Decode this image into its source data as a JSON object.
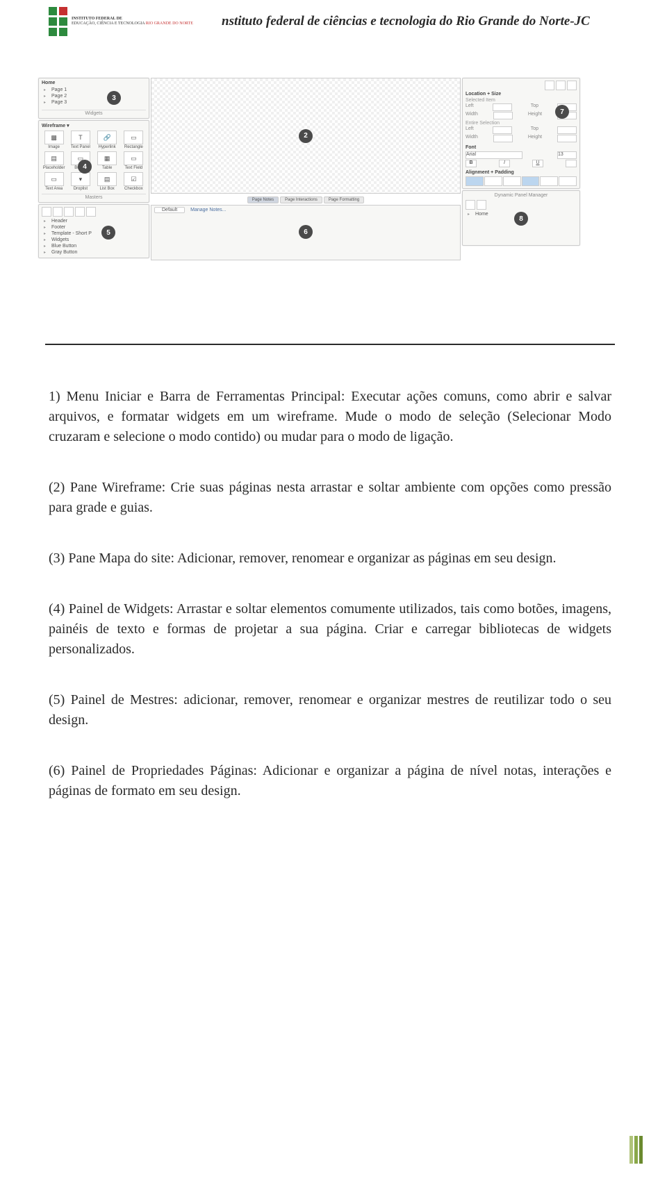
{
  "header": {
    "logo_line1": "INSTITUTO FEDERAL DE",
    "logo_line2": "EDUCAÇÃO, CIÊNCIA E TECNOLOGIA",
    "logo_line3": "RIO GRANDE DO NORTE",
    "title": "nstituto federal de ciências e tecnologia do Rio Grande do Norte-JC"
  },
  "ui": {
    "sitemap": {
      "title": "Home",
      "pages": [
        "Page 1",
        "Page 2",
        "Page 3"
      ],
      "footer": "Widgets",
      "callout": "3"
    },
    "widgets": {
      "title": "Wireframe ▾",
      "items": [
        {
          "label": "Image",
          "glyph": "▩"
        },
        {
          "label": "Text Panel",
          "glyph": "T"
        },
        {
          "label": "Hyperlink",
          "glyph": "🔗"
        },
        {
          "label": "Rectangle",
          "glyph": "▭"
        },
        {
          "label": "Placeholder",
          "glyph": "▤"
        },
        {
          "label": "Button",
          "glyph": "▭"
        },
        {
          "label": "Table",
          "glyph": "▦"
        },
        {
          "label": "Text Field",
          "glyph": "▭"
        },
        {
          "label": "Text Area",
          "glyph": "▭"
        },
        {
          "label": "Droplist",
          "glyph": "▾"
        },
        {
          "label": "List Box",
          "glyph": "▤"
        },
        {
          "label": "Checkbox",
          "glyph": "☑"
        }
      ],
      "callout": "4",
      "masters_label": "Masters"
    },
    "masters": {
      "items": [
        "Header",
        "Footer",
        "Template - Short P",
        "Widgets",
        "Blue Button",
        "Gray Button"
      ],
      "callout": "5"
    },
    "canvas": {
      "callout": "2"
    },
    "tabs": {
      "items": [
        "Page Notes",
        "Page Interactions",
        "Page Formatting"
      ],
      "active_index": 0
    },
    "notes": {
      "default_label": "Default",
      "manage": "Manage Notes...",
      "callout": "6"
    },
    "properties": {
      "section1": "Location + Size",
      "selected": "Selected Item",
      "left_lbl": "Left",
      "top_lbl": "Top",
      "width_lbl": "Width",
      "height_lbl": "Height",
      "entire": "Entire Selection",
      "font_section": "Font",
      "font_name": "Arial",
      "font_size": "13",
      "align_section": "Alignment + Padding",
      "callout": "7"
    },
    "dyn": {
      "title": "Dynamic Panel Manager",
      "home": "Home",
      "callout": "8"
    }
  },
  "paragraphs": [
    "1) Menu Iniciar e Barra de Ferramentas Principal: Executar ações comuns, como abrir e salvar arquivos, e formatar widgets em um wireframe. Mude o modo de seleção (Selecionar Modo cruzaram e selecione o modo contido) ou mudar para o modo de ligação.",
    "(2) Pane Wireframe: Crie suas páginas nesta arrastar e soltar ambiente com opções como pressão para grade e guias.",
    "(3) Pane Mapa do site: Adicionar, remover, renomear e organizar as páginas em seu design.",
    "(4) Painel de Widgets: Arrastar e soltar elementos comumente utilizados, tais como botões, imagens, painéis de texto e formas de projetar a sua página. Criar e carregar bibliotecas de widgets personalizados.",
    "(5) Painel de Mestres: adicionar, remover, renomear e organizar mestres de reutilizar todo o seu design.",
    "(6) Painel de Propriedades Páginas: Adicionar e organizar a página de nível notas, interações e páginas de formato em seu design."
  ]
}
